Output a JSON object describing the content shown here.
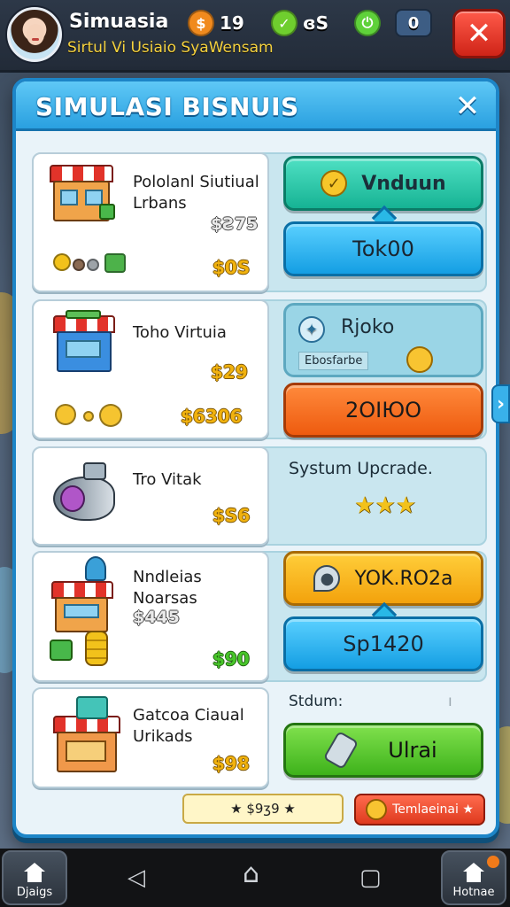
{
  "topbar": {
    "player_name": "Simuasia",
    "player_sub": "Sirtul Vi Usiaio SyaWensam",
    "stats": [
      "19",
      "ɞS",
      "0"
    ],
    "close_symbol": "✕"
  },
  "dialog": {
    "title": "SIMULASI BISNUIS",
    "close_symbol": "✕"
  },
  "rows": [
    {
      "title": "Pololanl Siutiual Lrbans",
      "price_top": "$Ƨ75",
      "price_bottom": "$0S",
      "btn_top": "Vnduun",
      "btn_bottom": "Tok00"
    },
    {
      "title": "Toho Virtuia",
      "price_top": "$29",
      "price_bottom": "$6306",
      "btn_top": "Rjoko",
      "btn_top_sub": "Ebosfarbe",
      "btn_bottom": "2OIЮO"
    },
    {
      "title": "Tro Vitak",
      "price_bottom": "$S6",
      "upgrade_title": "Systum Upcrade.",
      "stars": "★★★"
    },
    {
      "title": "Nndleias Noarsas",
      "price_mid": "$445",
      "price_bottom": "$90",
      "btn_top": "YOK.RO2a",
      "btn_bottom": "Sp1420"
    },
    {
      "title": "Gatcoa Ciaual Urikads",
      "price_bottom": "$98",
      "side_label": "Stdum:",
      "side_mark": "ı",
      "btn_bottom": "Ulrai"
    }
  ],
  "footer": {
    "mini_bar_text": "★ $9ʒ9 ★",
    "mini_btn_text": "Temlaeinai ★"
  },
  "navbar": {
    "left_label": "Djaigs",
    "right_label": "Hotnae",
    "back_symbol": "◁",
    "home_symbol": "⌂",
    "recent_symbol": "▢"
  },
  "colors": {
    "accent": "#2aa0e0",
    "danger": "#e2332a",
    "price": "#f1b20e",
    "price_green": "#48c52a"
  },
  "icons": [
    "shop-icon",
    "check-icon",
    "compass-icon",
    "star-icon",
    "key-icon",
    "home-icon"
  ]
}
